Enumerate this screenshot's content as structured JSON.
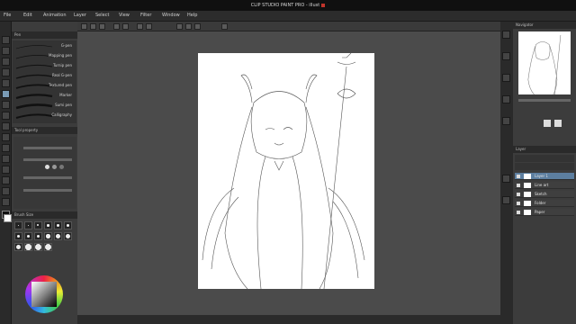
{
  "window": {
    "title": "CLIP STUDIO PAINT PRO - illust"
  },
  "menu": {
    "items": [
      "File",
      "Edit",
      "Animation",
      "Layer",
      "Select",
      "View",
      "Filter",
      "Window",
      "Help"
    ]
  },
  "left_panel": {
    "sub_tool_tab": "Pen",
    "brushes": [
      {
        "label": "G-pen",
        "width": 0.6
      },
      {
        "label": "Mapping pen",
        "width": 0.8
      },
      {
        "label": "Turnip pen",
        "width": 1.0
      },
      {
        "label": "Real G-pen",
        "width": 1.4
      },
      {
        "label": "Textured pen",
        "width": 1.8
      },
      {
        "label": "Marker",
        "width": 2.2
      },
      {
        "label": "Sumi pen",
        "width": 2.6
      },
      {
        "label": "Calligraphy",
        "width": 2.0
      }
    ],
    "tool_property_tab": "Tool property",
    "brush_size_tab": "Brush Size",
    "brush_sizes": [
      0.3,
      0.5,
      0.7,
      1,
      1.5,
      2,
      3,
      4,
      5,
      7,
      10,
      12,
      15,
      20,
      25,
      30
    ]
  },
  "right_panel": {
    "navigator_tab": "Navigator",
    "layer_tab": "Layer",
    "layers": [
      "Layer 1",
      "Line art",
      "Sketch",
      "Folder",
      "Paper"
    ]
  },
  "colors": {
    "panel": "#3c3c3c",
    "dark": "#2a2a2a",
    "accent": "#5d7fa0",
    "canvas_bg": "#4b4b4b"
  }
}
